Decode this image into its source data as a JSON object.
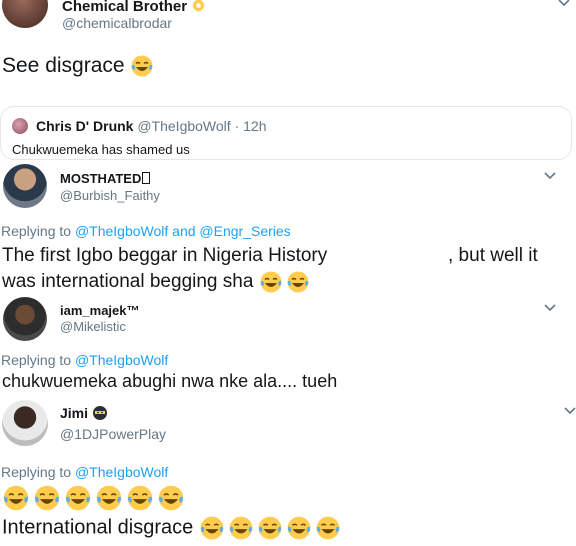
{
  "tweet1": {
    "name": "Chemical Brother",
    "handle": "@chemicalbrodar",
    "text": "See disgrace",
    "emoji": "tears-of-joy"
  },
  "quote": {
    "name": "Chris D' Drunk",
    "handle": "@TheIgboWolf",
    "time": "· 12h",
    "text": "Chukwuemeka has shamed us"
  },
  "reply1": {
    "name": "MOSTHATED",
    "handle": "@Burbish_Faithy",
    "replying_prefix": "Replying to",
    "replying_to": "@TheIgboWolf and @Engr_Series",
    "line1_a": "The first Igbo beggar in Nigeria History",
    "line1_b": ", but well it",
    "line2": "was international begging sha",
    "emoji_count": 2
  },
  "reply2": {
    "name": "iam_majek™",
    "handle": "@Mikelistic",
    "replying_prefix": "Replying to",
    "replying_to": "@TheIgboWolf",
    "text": "chukwuemeka abughi nwa nke ala.... tueh"
  },
  "reply3": {
    "name": "Jimi",
    "handle": "@1DJPowerPlay",
    "replying_prefix": "Replying to",
    "replying_to": "@TheIgboWolf",
    "emoji_row_count": 6,
    "text": "International disgrace",
    "trailing_emoji_count": 5
  },
  "colors": {
    "link": "#1da1f2",
    "secondary": "#657786",
    "border": "#e1e8ed",
    "emoji_face": "#ffcc4d",
    "emoji_tear": "#5dadec"
  }
}
